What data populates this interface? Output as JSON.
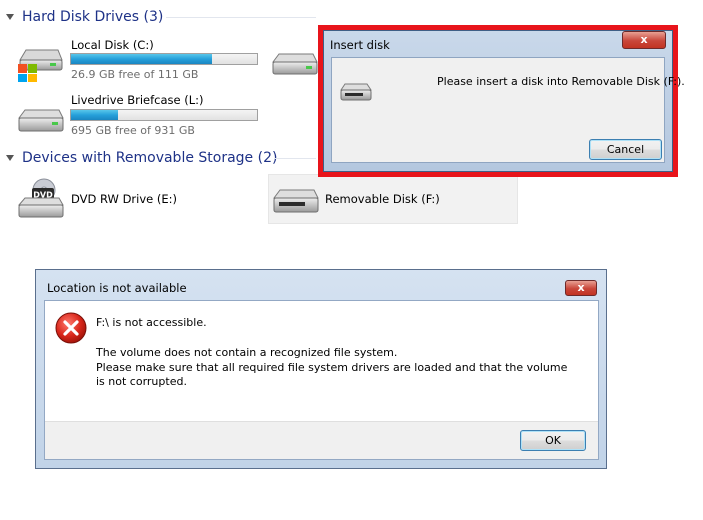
{
  "explorer": {
    "groups": {
      "hard_disk": "Hard Disk Drives (3)",
      "removable": "Devices with Removable Storage (2)"
    },
    "drives": {
      "local_c": {
        "name": "Local Disk (C:)",
        "free": "26.9 GB free of 111 GB",
        "used_fraction": 0.76
      },
      "livedrive_l": {
        "name": "Livedrive Briefcase (L:)",
        "free": "695 GB free of 931 GB",
        "used_fraction": 0.25
      },
      "dvd_e": {
        "name": "DVD RW Drive (E:)",
        "badge": "DVD"
      },
      "removable_f": {
        "name": "Removable Disk (F:)"
      }
    }
  },
  "insert_dialog": {
    "title": "Insert disk",
    "message": "Please insert a disk into Removable Disk (F:).",
    "cancel_label": "Cancel",
    "close_glyph": "x",
    "highlight_color": "#e8141b"
  },
  "error_dialog": {
    "title": "Location is not available",
    "line1": "F:\\ is not accessible.",
    "line2": "The volume does not contain a recognized file system.",
    "line3": "Please make sure that all required file system drivers are loaded and that the volume is not corrupted.",
    "ok_label": "OK",
    "close_glyph": "x",
    "icon": "error-x-icon"
  }
}
